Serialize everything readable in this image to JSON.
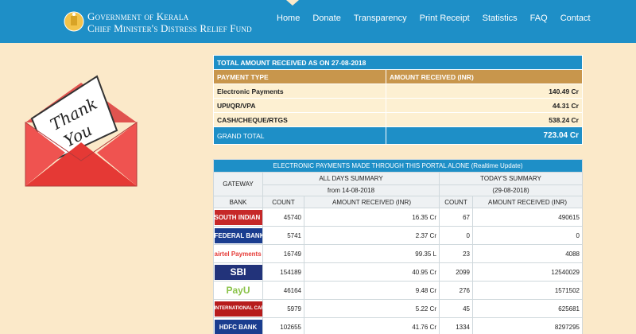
{
  "header": {
    "brand_line1": "Government of Kerala",
    "brand_line2": "Chief Minister's Distress Relief Fund",
    "nav": [
      "Home",
      "Donate",
      "Transparency",
      "Print Receipt",
      "Statistics",
      "FAQ",
      "Contact"
    ],
    "active_nav": "Home",
    "colors": {
      "bar": "#1e8fc7",
      "page": "#fbe9c9"
    }
  },
  "illustration": {
    "text_line1": "Thank",
    "text_line2": "You"
  },
  "summary": {
    "title": "TOTAL AMOUNT RECEIVED AS ON 27-08-2018",
    "col1": "PAYMENT TYPE",
    "col2": "AMOUNT RECEIVED (INR)",
    "rows": [
      {
        "type": "Electronic Payments",
        "amount": "140.49 Cr"
      },
      {
        "type": "UPI/QR/VPA",
        "amount": "44.31 Cr"
      },
      {
        "type": "CASH/CHEQUE/RTGS",
        "amount": "538.24 Cr"
      }
    ],
    "total_label": "GRAND TOTAL",
    "total_amount": "723.04 Cr"
  },
  "gateway": {
    "title": "ELECTRONIC PAYMENTS MADE THROUGH THIS PORTAL ALONE (Realtime Update)",
    "gateway_label": "GATEWAY",
    "all_days": "ALL DAYS SUMMARY",
    "all_days_sub": "from 14-08-2018",
    "today": "TODAY'S SUMMARY",
    "today_sub": "(29-08-2018)",
    "cols": [
      "BANK",
      "COUNT",
      "AMOUNT RECEIVED (INR)",
      "COUNT",
      "AMOUNT RECEIVED (INR)"
    ],
    "rows": [
      {
        "bank": "SOUTH INDIAN Bank",
        "count": "45740",
        "amount": "16.35 Cr",
        "today_count": "67",
        "today_amount": "490615",
        "color": "#c62828"
      },
      {
        "bank": "FEDERAL BANK",
        "count": "5741",
        "amount": "2.37 Cr",
        "today_count": "0",
        "today_amount": "0",
        "color": "#1a3d8f"
      },
      {
        "bank": "airtel Payments Bank",
        "count": "16749",
        "amount": "99.35 L",
        "today_count": "23",
        "today_amount": "4088",
        "color": "#e53935"
      },
      {
        "bank": "SBI",
        "count": "154189",
        "amount": "40.95 Cr",
        "today_count": "2099",
        "today_amount": "12540029",
        "color": "#22337a"
      },
      {
        "bank": "PayU",
        "count": "46164",
        "amount": "9.48 Cr",
        "today_count": "276",
        "today_amount": "1571502",
        "color": "#8bc34a"
      },
      {
        "bank": "INTERNATIONAL CARDS",
        "count": "5979",
        "amount": "5.22 Cr",
        "today_count": "45",
        "today_amount": "625681",
        "color": "#b71c1c"
      },
      {
        "bank": "HDFC BANK",
        "count": "102655",
        "amount": "41.76 Cr",
        "today_count": "1334",
        "today_amount": "8297295",
        "color": "#1a3d8f"
      }
    ]
  }
}
